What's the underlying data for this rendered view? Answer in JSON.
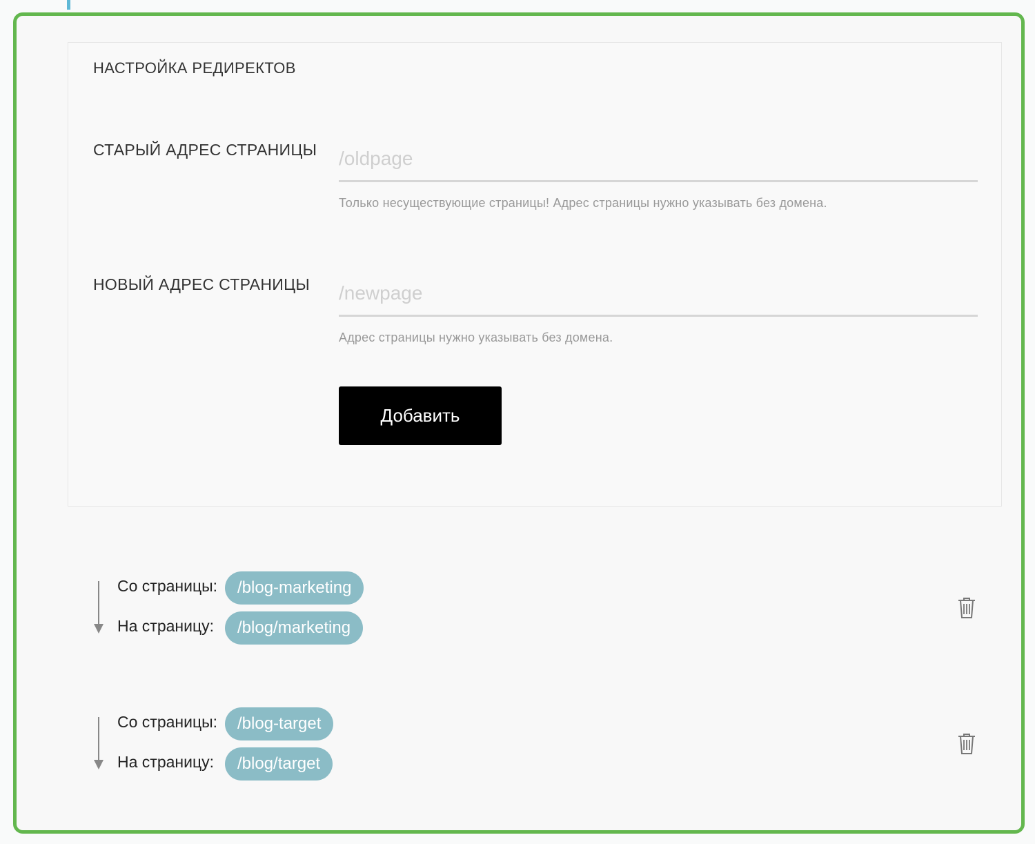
{
  "settings": {
    "title": "НАСТРОЙКА РЕДИРЕКТОВ",
    "old_address": {
      "label": "СТАРЫЙ АДРЕС СТРАНИЦЫ",
      "placeholder": "/oldpage",
      "value": "",
      "hint": "Только несуществующие страницы! Адрес страницы нужно указывать без домена."
    },
    "new_address": {
      "label": "НОВЫЙ АДРЕС СТРАНИЦЫ",
      "placeholder": "/newpage",
      "value": "",
      "hint": "Адрес страницы нужно указывать без домена."
    },
    "add_button_label": "Добавить"
  },
  "redirects": [
    {
      "from_label": "Со страницы:",
      "from": "/blog-marketing",
      "to_label": "На страницу:",
      "to": "/blog/marketing",
      "delete_icon": "trash-icon"
    },
    {
      "from_label": "Со страницы:",
      "from": "/blog-target",
      "to_label": "На страницу:",
      "to": "/blog/target",
      "delete_icon": "trash-icon"
    }
  ],
  "colors": {
    "frame_border": "#63b74e",
    "pill_background": "#8bbcc6",
    "button_background": "#000000"
  }
}
